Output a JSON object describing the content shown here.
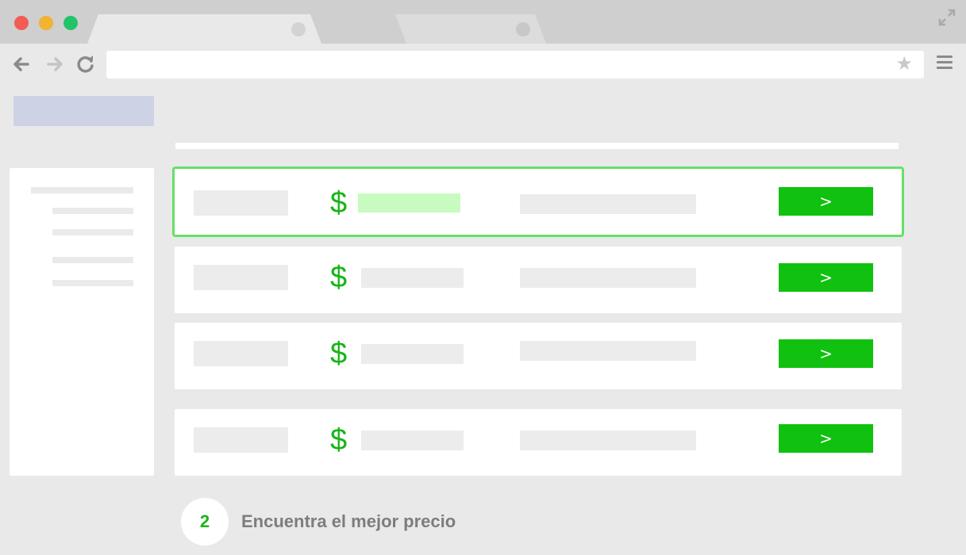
{
  "browser": {
    "star_glyph": "★",
    "colors": {
      "close": "#f25c54",
      "minimize": "#f2b233",
      "maximize": "#22c46a"
    }
  },
  "results": [
    {
      "currency_symbol": "$",
      "button_label": ">",
      "highlighted": true
    },
    {
      "currency_symbol": "$",
      "button_label": ">",
      "highlighted": false
    },
    {
      "currency_symbol": "$",
      "button_label": ">",
      "highlighted": false
    },
    {
      "currency_symbol": "$",
      "button_label": ">",
      "highlighted": false
    }
  ],
  "footer": {
    "step_number": "2",
    "step_text": "Encuentra el mejor precio"
  },
  "colors": {
    "accent": "#10c10f",
    "highlight_border": "#66e066",
    "highlight_fill": "#c8fbc0"
  }
}
